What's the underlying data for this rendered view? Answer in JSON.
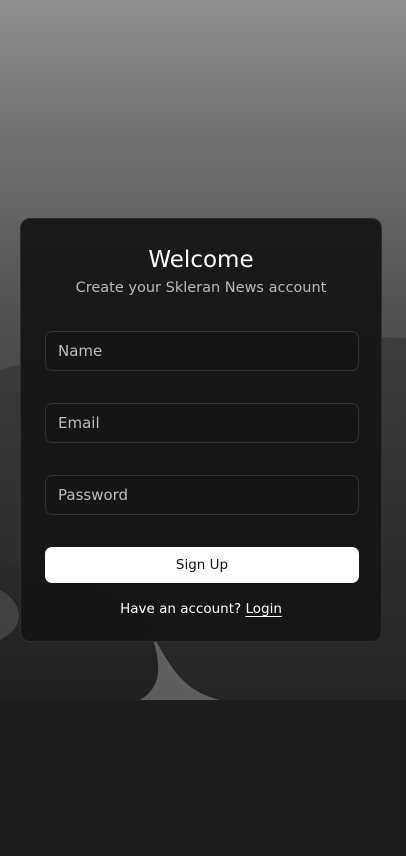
{
  "card": {
    "title": "Welcome",
    "subtitle": "Create your Skleran News account"
  },
  "form": {
    "name_placeholder": "Name",
    "email_placeholder": "Email",
    "password_placeholder": "Password",
    "submit_label": "Sign Up"
  },
  "footer": {
    "prompt": "Have an account?",
    "login_label": "Login"
  },
  "colors": {
    "card_background": "#141414",
    "button_background": "#ffffff",
    "button_text": "#111111",
    "subtitle_text": "#b9b9b9"
  }
}
